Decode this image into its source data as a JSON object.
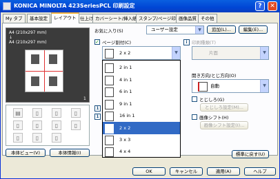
{
  "window": {
    "title": "KONICA MINOLTA 423SeriesPCL 印刷設定",
    "help": "?",
    "close": "✕"
  },
  "tabs": [
    "My タブ",
    "基本設定",
    "レイアウト",
    "仕上げ",
    "カバーシート/挿入紙",
    "スタンプ/ページ印字",
    "画像品質",
    "その他"
  ],
  "preview": {
    "paper_line1": "A4 (210x297 mm)",
    "paper_arrow": "↓",
    "paper_line2": "A4 (210x297 mm)",
    "page_num": "1"
  },
  "left_buttons": {
    "unit_view": "本体ビュー(V)",
    "unit_info": "本体情報(I)"
  },
  "favorites": {
    "label": "お気に入り(S)",
    "value": "ユーザー設定",
    "add": "追加(L)...",
    "edit": "編集(E)..."
  },
  "page_combine": {
    "label": "ページ割付(C)",
    "value": "2 x 2",
    "checked": "✓"
  },
  "dropdown_items": [
    "2 in 1",
    "4 in 1",
    "6 in 1",
    "9 in 1",
    "16 in 1",
    "2 x 2",
    "3 x 3",
    "4 x 4"
  ],
  "print_type": {
    "label": "印刷種類(T)",
    "value": "片面"
  },
  "orientation": {
    "label": "開き方向/とじ方向(O)",
    "value": "自動"
  },
  "binding": {
    "label": "とじしろ(G)",
    "settings": "とじしろ設定(M)..."
  },
  "image_shift": {
    "label": "画像シフト(H)",
    "settings": "画像シフト設定(I)..."
  },
  "info_marks": {
    "icon": "i",
    "page_num_1": "1",
    "page_num_2": "1"
  },
  "restore_button": "標準に戻す(U)",
  "footer": {
    "ok": "OK",
    "cancel": "キャンセル",
    "apply": "適用(A)",
    "help": "ヘルプ"
  }
}
